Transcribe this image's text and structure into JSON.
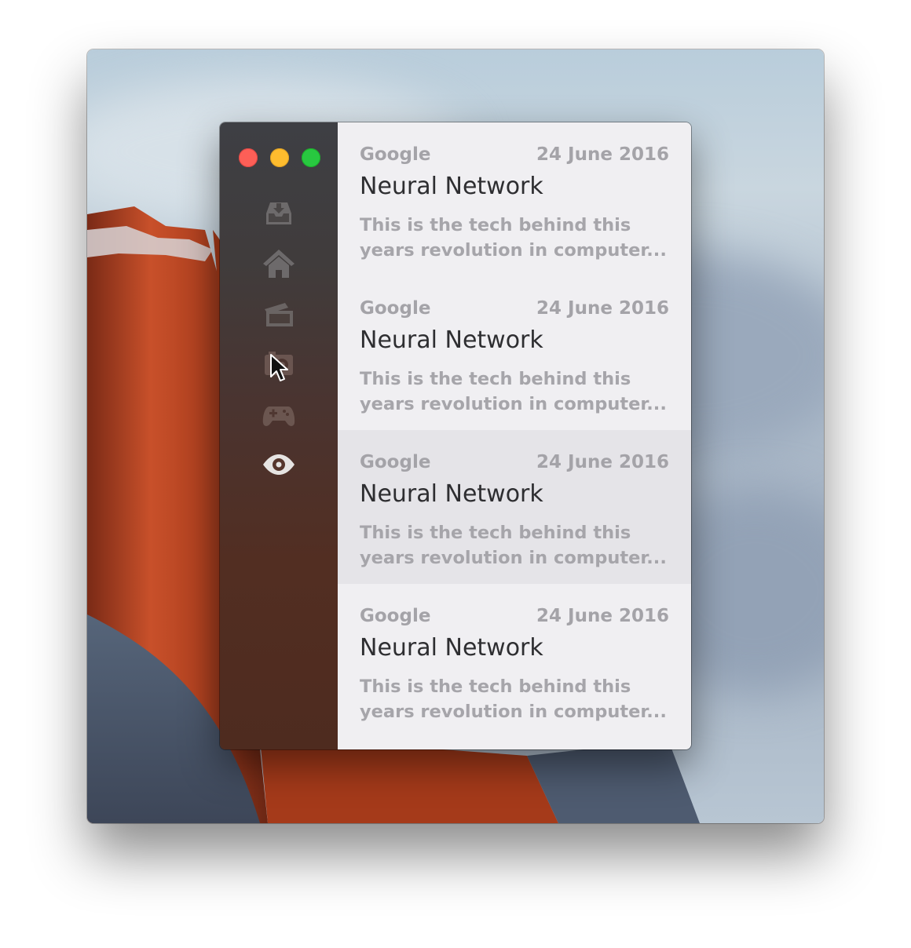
{
  "window": {
    "controls": [
      "close",
      "minimize",
      "maximize"
    ]
  },
  "sidebar": {
    "items": [
      {
        "icon": "inbox-download-icon",
        "active": false
      },
      {
        "icon": "home-icon",
        "active": false
      },
      {
        "icon": "stacked-windows-icon",
        "active": false
      },
      {
        "icon": "camera-icon",
        "active": false
      },
      {
        "icon": "gamepad-icon",
        "active": false
      },
      {
        "icon": "eye-icon",
        "active": true
      }
    ]
  },
  "articles": [
    {
      "source": "Google",
      "date": "24 June 2016",
      "title": "Neural Network",
      "excerpt": "This is the tech behind this years revolution in computer...",
      "selected": false
    },
    {
      "source": "Google",
      "date": "24 June 2016",
      "title": "Neural Network",
      "excerpt": "This is the tech behind this years revolution in computer...",
      "selected": false
    },
    {
      "source": "Google",
      "date": "24 June 2016",
      "title": "Neural Network",
      "excerpt": "This is the tech behind this years revolution in computer...",
      "selected": true
    },
    {
      "source": "Google",
      "date": "24 June 2016",
      "title": "Neural Network",
      "excerpt": "This is the tech behind this years revolution in computer...",
      "selected": false
    }
  ],
  "colors": {
    "close": "#fd5f57",
    "minimize": "#febc2e",
    "maximize": "#28c840",
    "list_background": "#f0eff2",
    "selected_row": "#e5e4e8",
    "meta_text": "#a4a3a8",
    "title_text": "#2e2e31",
    "icon_inactive": "#6b6868",
    "icon_active": "#e6e4e2"
  }
}
